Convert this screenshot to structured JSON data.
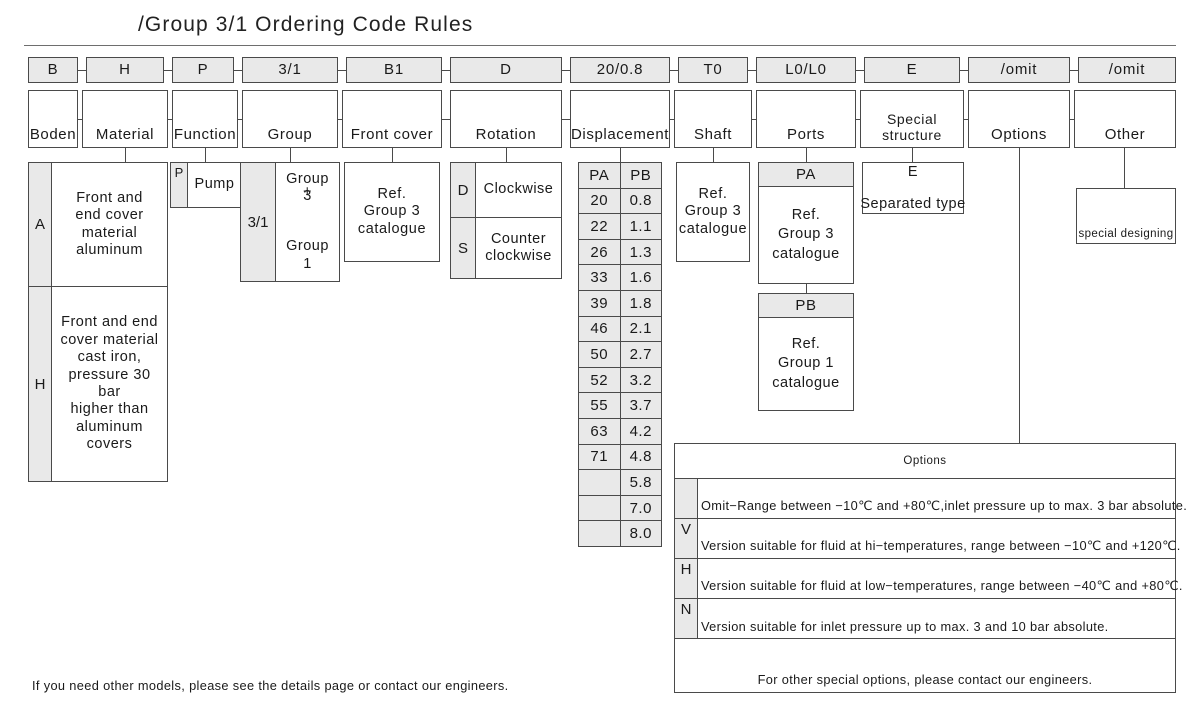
{
  "title": "/Group 3/1 Ordering Code Rules",
  "code_row": [
    {
      "code": "B",
      "label": "Boden"
    },
    {
      "code": "H",
      "label": "Material"
    },
    {
      "code": "P",
      "label": "Function"
    },
    {
      "code": "3/1",
      "label": "Group"
    },
    {
      "code": "B1",
      "label": "Front cover"
    },
    {
      "code": "D",
      "label": "Rotation"
    },
    {
      "code": "20/0.8",
      "label": "Displacement"
    },
    {
      "code": "T0",
      "label": "Shaft"
    },
    {
      "code": "L0/L0",
      "label": "Ports"
    },
    {
      "code": "E",
      "label": "Special structure"
    },
    {
      "code": "/omit",
      "label": "Options"
    },
    {
      "code": "/omit",
      "label": "Other"
    }
  ],
  "material": {
    "rows": [
      {
        "key": "A",
        "text": "Front and\nend cover\nmaterial\naluminum"
      },
      {
        "key": "H",
        "text": "Front and end\ncover material\ncast iron,\npressure 30 bar\nhigher than\naluminum covers"
      }
    ]
  },
  "function": {
    "key": "P",
    "value": "Pump"
  },
  "group": {
    "key": "3/1",
    "line1": "Group 3",
    "line2": "+",
    "line3": "Group 1"
  },
  "front_cover": {
    "text": "Ref.\nGroup 3\ncatalogue"
  },
  "rotation": {
    "rows": [
      {
        "key": "D",
        "text": "Clockwise"
      },
      {
        "key": "S",
        "text": "Counter\nclockwise"
      }
    ]
  },
  "displacement": {
    "headers": [
      "PA",
      "PB"
    ],
    "pa": [
      "20",
      "22",
      "26",
      "33",
      "39",
      "46",
      "50",
      "52",
      "55",
      "63",
      "71",
      "",
      "",
      ""
    ],
    "pb": [
      "0.8",
      "1.1",
      "1.3",
      "1.6",
      "1.8",
      "2.1",
      "2.7",
      "3.2",
      "3.7",
      "4.2",
      "4.8",
      "5.8",
      "7.0",
      "8.0"
    ]
  },
  "shaft": {
    "text": "Ref.\nGroup 3\ncatalogue"
  },
  "ports": {
    "cards": [
      {
        "head": "PA",
        "body": "Ref.\nGroup 3\ncatalogue"
      },
      {
        "head": "PB",
        "body": "Ref.\nGroup 1\ncatalogue"
      }
    ]
  },
  "special_structure": {
    "code": "E",
    "text": "Separated type"
  },
  "other": {
    "text": "special designing"
  },
  "options_table": {
    "title": "Options",
    "rows": [
      {
        "key": "",
        "text": "Omit−Range between −10℃ and +80℃,inlet pressure up to max. 3 bar absolute."
      },
      {
        "key": "V",
        "text": "Version suitable for fluid at hi−temperatures, range between −10℃ and +120℃."
      },
      {
        "key": "H",
        "text": "Version suitable for fluid at low−temperatures, range between −40℃ and +80℃."
      },
      {
        "key": "N",
        "text": "Version suitable for inlet pressure up to max. 3 and 10 bar absolute."
      }
    ],
    "footer": "For other special options, please contact our engineers."
  },
  "footnote": "If you need other models, please see the details page or contact our engineers.",
  "colors": {
    "shade": "#e9e9e9",
    "stroke": "#4a4a4a",
    "rule": "#6e6e6e",
    "text": "#1a1a1a"
  }
}
